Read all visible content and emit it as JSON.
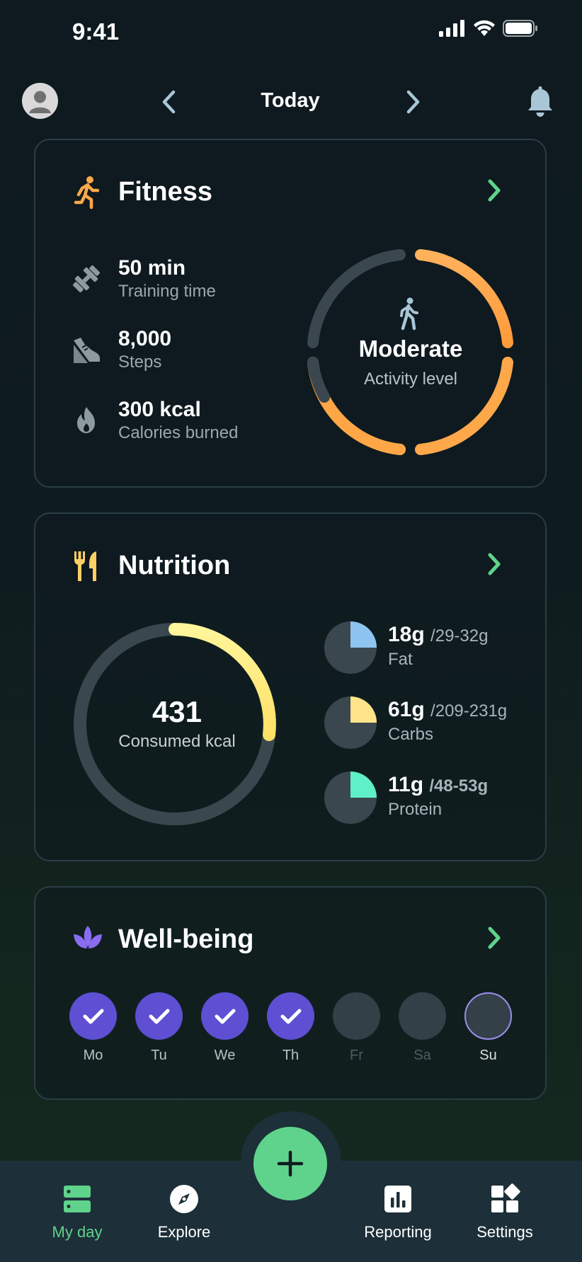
{
  "status_bar": {
    "time": "9:41"
  },
  "header": {
    "date_label": "Today"
  },
  "colors": {
    "accent_green": "#5fd38c",
    "fitness_orange": "#ffa84a",
    "wellbeing_purple": "#5e4fd3",
    "ring_track": "#3a474e",
    "calorie_yellow": "#fff080"
  },
  "fitness": {
    "title": "Fitness",
    "stats": [
      {
        "value": "50 min",
        "label": "Training time",
        "icon": "dumbbell-icon"
      },
      {
        "value": "8,000",
        "label": "Steps",
        "icon": "shoe-icon"
      },
      {
        "value": "300 kcal",
        "label": "Calories burned",
        "icon": "flame-icon"
      }
    ],
    "activity": {
      "level": "Moderate",
      "label": "Activity level",
      "icon": "walking-icon",
      "progress": 0.75
    }
  },
  "nutrition": {
    "title": "Nutrition",
    "consumed": {
      "value": "431",
      "label": "Consumed kcal",
      "progress": 0.2
    },
    "macros": [
      {
        "amount": "18g",
        "range": "/29-32g",
        "name": "Fat",
        "color": "#8ec5f0",
        "progress": 0.25
      },
      {
        "amount": "61g",
        "range": "/209-231g",
        "name": "Carbs",
        "color": "#ffe48a",
        "progress": 0.25
      },
      {
        "amount": "11g",
        "range": "/48-53g",
        "name": "Protein",
        "color": "#5ff0c8",
        "progress": 0.25
      }
    ]
  },
  "wellbeing": {
    "title": "Well-being",
    "days": [
      {
        "label": "Mo",
        "state": "done"
      },
      {
        "label": "Tu",
        "state": "done"
      },
      {
        "label": "We",
        "state": "done"
      },
      {
        "label": "Th",
        "state": "done"
      },
      {
        "label": "Fr",
        "state": "empty"
      },
      {
        "label": "Sa",
        "state": "empty"
      },
      {
        "label": "Su",
        "state": "today"
      }
    ]
  },
  "tabbar": {
    "tabs": [
      {
        "label": "My day",
        "icon": "my-day-icon",
        "active": true
      },
      {
        "label": "Explore",
        "icon": "compass-icon",
        "active": false
      },
      {
        "label": "Reporting",
        "icon": "bar-chart-icon",
        "active": false
      },
      {
        "label": "Settings",
        "icon": "grid-settings-icon",
        "active": false
      }
    ],
    "fab_icon": "plus-icon"
  }
}
